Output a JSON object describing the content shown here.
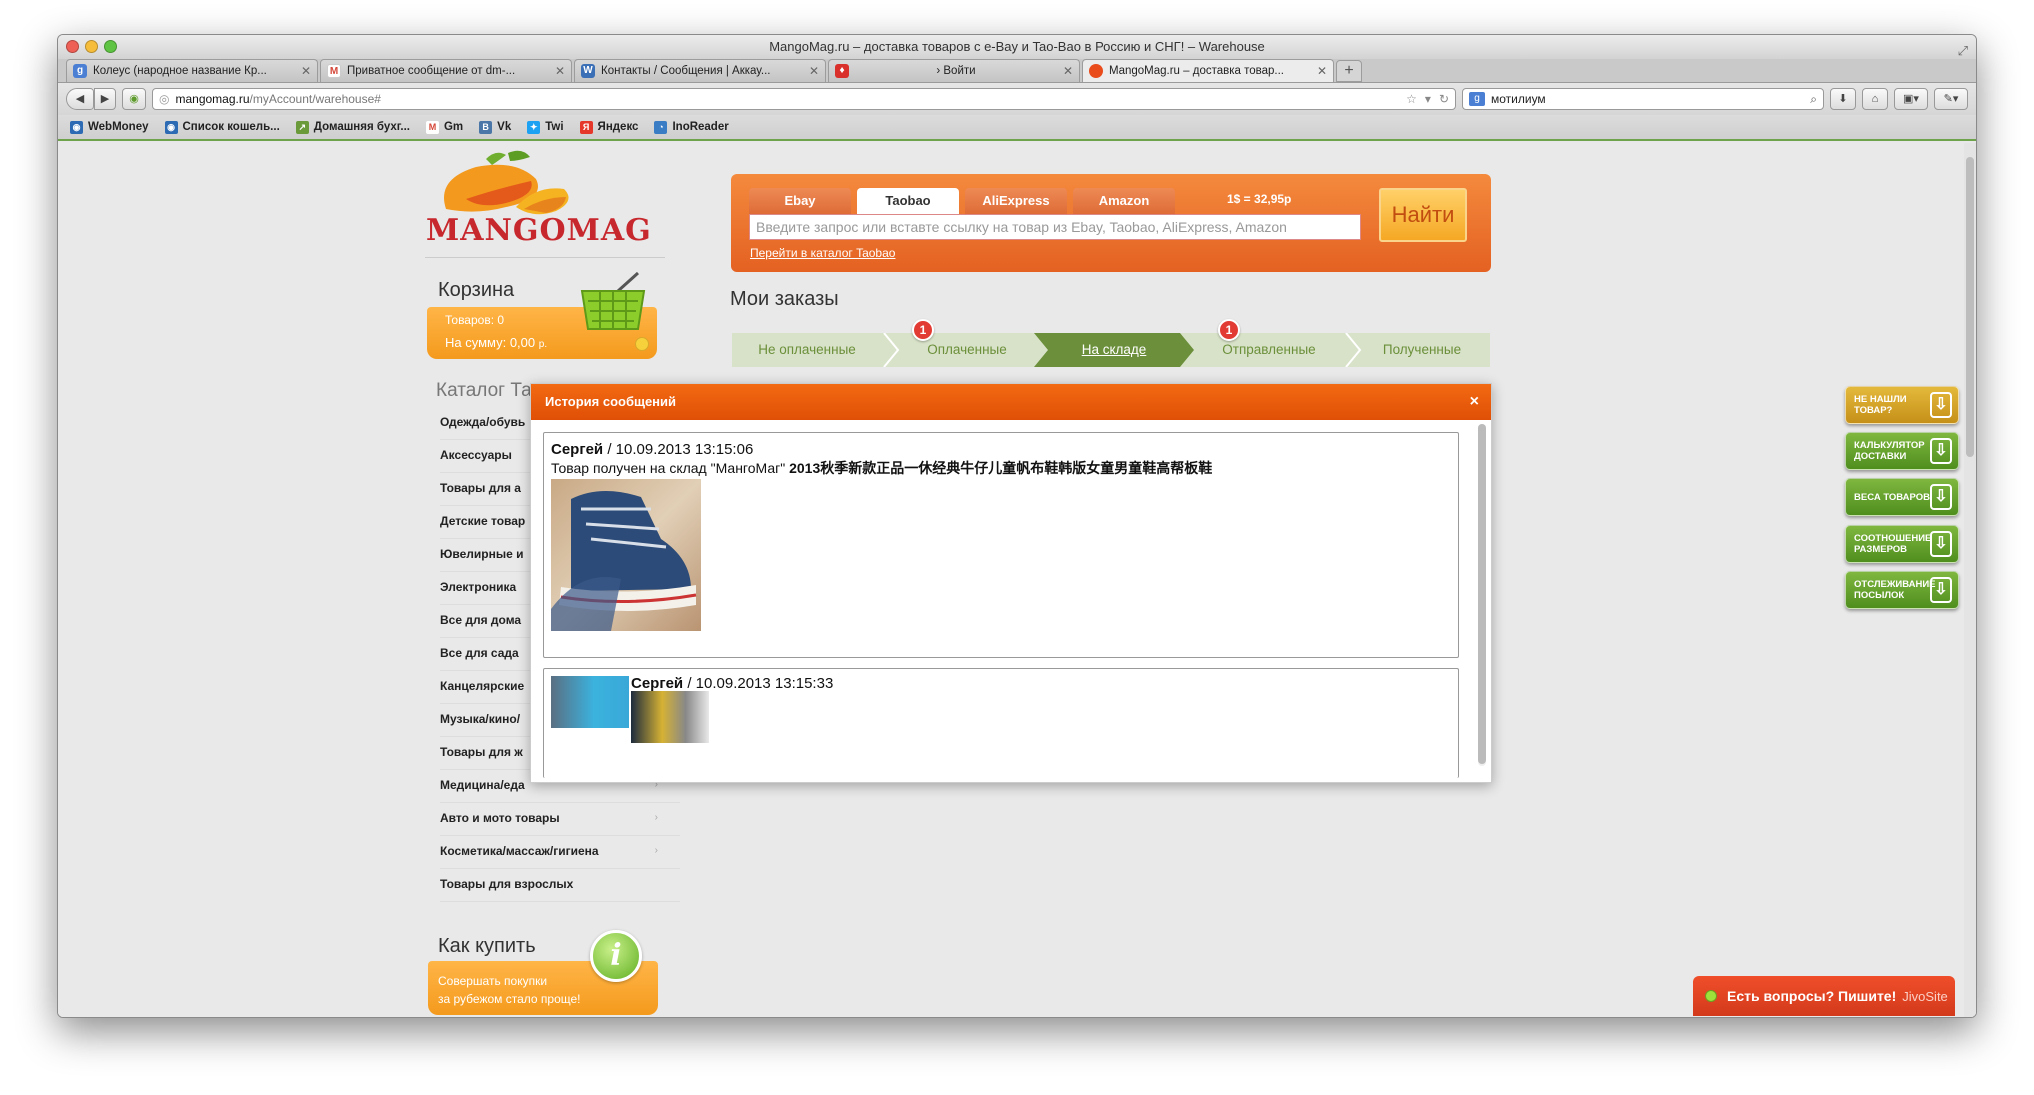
{
  "window": {
    "title": "MangoMag.ru – доставка товаров с e-Bay и Tao-Bao в Россию и СНГ! – Warehouse"
  },
  "tabs": [
    {
      "label": "Колеус (народное название Кр...",
      "icon": "google-icon",
      "color": "#4a7fd4"
    },
    {
      "label": "Приватное сообщение от dm-...",
      "icon": "gmail-icon",
      "color": "#d44638"
    },
    {
      "label": "Контакты / Сообщения | Аккау...",
      "icon": "w-icon",
      "color": "#3b6fb6"
    },
    {
      "label": "› Войти",
      "icon": "site-icon",
      "color": "#d9302c"
    },
    {
      "label": "MangoMag.ru – доставка товар...",
      "icon": "mango-icon",
      "color": "#e94b1b",
      "active": true
    }
  ],
  "nav": {
    "url_host": "mangomag.ru",
    "url_path": "/myAccount/warehouse#",
    "search_value": "мотилиум"
  },
  "bookmarks": [
    {
      "label": "WebMoney",
      "color": "#2d6ab4"
    },
    {
      "label": "Список кошель...",
      "color": "#2d6ab4"
    },
    {
      "label": "Домашняя бухг...",
      "color": "#6a9a3a"
    },
    {
      "label": "Gm",
      "color": "#d44638"
    },
    {
      "label": "Vk",
      "color": "#4a76a8"
    },
    {
      "label": "Twi",
      "color": "#1da1f2"
    },
    {
      "label": "Яндекс",
      "color": "#e6372b"
    },
    {
      "label": "InoReader",
      "color": "#3b7dc4"
    }
  ],
  "logo": {
    "text": "MANGOMAG"
  },
  "cart": {
    "title": "Корзина",
    "count_label": "Товаров: 0",
    "sum_label": "На сумму: 0,00",
    "currency": "р."
  },
  "catalog": {
    "title": "Каталог Та",
    "items": [
      "Одежда/обувь",
      "Аксессуары",
      "Товары для а",
      "Детские товар",
      "Ювелирные и",
      "Электроника",
      "Все для дома",
      "Все для сада",
      "Канцелярские",
      "Музыка/кино/",
      "Товары для ж",
      "Медицина/еда",
      "Авто и мото товары",
      "Косметика/массаж/гигиена",
      "Товары для взрослых"
    ]
  },
  "howto": {
    "title": "Как купить",
    "line1": "Совершать покупки",
    "line2": "за рубежом стало проще!"
  },
  "search": {
    "tabs": [
      "Ebay",
      "Taobao",
      "AliExpress",
      "Amazon"
    ],
    "active_tab": 1,
    "rate": "1$ = 32,95р",
    "placeholder": "Введите запрос или вставте ссылку на товар из Ebay, Taobao, AliExpress, Amazon",
    "button": "Найти",
    "catalog_link": "Перейти в каталог Taobao"
  },
  "orders": {
    "title": "Мои заказы",
    "steps": [
      {
        "label": "Не оплаченные",
        "badge": "1"
      },
      {
        "label": "Оплаченные"
      },
      {
        "label": "На складе",
        "badge": "1",
        "active": true
      },
      {
        "label": "Отправленные"
      },
      {
        "label": "Полученные"
      }
    ]
  },
  "modal": {
    "title": "История сообщений",
    "close": "×",
    "messages": [
      {
        "author": "Сергей",
        "date": " / 10.09.2013 13:15:06",
        "text": "Товар получен на склад \"МангоМаг\" ",
        "product": "2013秋季新款正品一休经典牛仔儿童帆布鞋韩版女童男童鞋高帮板鞋"
      },
      {
        "author": "Сергей",
        "date": " / 10.09.2013 13:15:33"
      }
    ]
  },
  "side_buttons": [
    {
      "l1": "НЕ НАШЛИ",
      "l2": "ТОВАР?"
    },
    {
      "l1": "КАЛЬКУЛЯТОР",
      "l2": "ДОСТАВКИ"
    },
    {
      "l1": "ВЕСА ТОВАРОВ",
      "l2": ""
    },
    {
      "l1": "СООТНОШЕНИЕ",
      "l2": "РАЗМЕРОВ"
    },
    {
      "l1": "ОТСЛЕЖИВАНИЕ",
      "l2": "ПОСЫЛОК"
    }
  ],
  "jivo": {
    "text": "Есть вопросы? Пишите!",
    "brand": "JivoSite"
  },
  "colors": {
    "accent_orange": "#e46122",
    "green": "#6b8f3a",
    "cart_orange": "#f49a1d"
  }
}
